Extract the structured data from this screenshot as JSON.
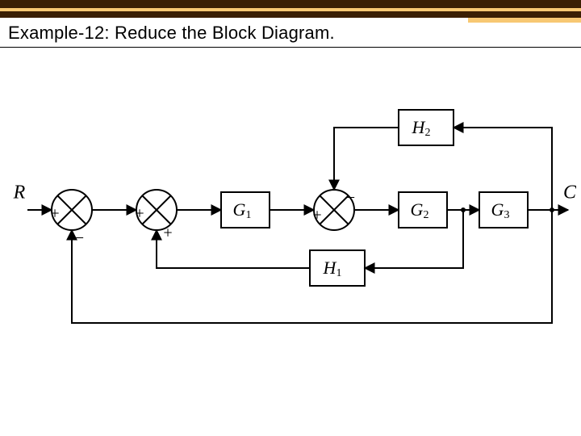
{
  "title": "Example-12: Reduce the Block Diagram.",
  "input_label": "R",
  "output_label": "C",
  "blocks": {
    "G1": "G",
    "G1_sub": "1",
    "G2": "G",
    "G2_sub": "2",
    "G3": "G",
    "G3_sub": "3",
    "H1": "H",
    "H1_sub": "1",
    "H2": "H",
    "H2_sub": "2"
  },
  "sums": {
    "s1_left": "+",
    "s1_bottom": "_",
    "s2_left": "+",
    "s2_bottom": "+",
    "s3_left": "+",
    "s3_top": "_"
  },
  "diagram_data": {
    "type": "block_diagram",
    "description": "Control-system block diagram with three summing junctions, forward blocks G1 G2 G3, feedback blocks H1 (positive, inner) and H2 (negative, middle), and unity negative feedback (outer).",
    "nodes": [
      {
        "id": "R",
        "kind": "input"
      },
      {
        "id": "S1",
        "kind": "sum",
        "signs": {
          "left": "+",
          "bottom": "-"
        }
      },
      {
        "id": "S2",
        "kind": "sum",
        "signs": {
          "left": "+",
          "bottom": "+"
        }
      },
      {
        "id": "G1",
        "kind": "block",
        "label": "G1"
      },
      {
        "id": "S3",
        "kind": "sum",
        "signs": {
          "left": "+",
          "top": "-"
        }
      },
      {
        "id": "G2",
        "kind": "block",
        "label": "G2"
      },
      {
        "id": "G3",
        "kind": "block",
        "label": "G3"
      },
      {
        "id": "C",
        "kind": "output"
      },
      {
        "id": "H1",
        "kind": "block",
        "label": "H1"
      },
      {
        "id": "H2",
        "kind": "block",
        "label": "H2"
      }
    ],
    "edges": [
      {
        "from": "R",
        "to": "S1"
      },
      {
        "from": "S1",
        "to": "S2"
      },
      {
        "from": "S2",
        "to": "G1"
      },
      {
        "from": "G1",
        "to": "S3"
      },
      {
        "from": "S3",
        "to": "G2"
      },
      {
        "from": "G2",
        "to": "G3"
      },
      {
        "from": "G3",
        "to": "C"
      },
      {
        "from": "G2_out",
        "to": "H1",
        "tap": "between G2 and G3"
      },
      {
        "from": "H1",
        "to": "S2",
        "sign": "+"
      },
      {
        "from": "C_tap",
        "to": "H2",
        "tap": "after G3"
      },
      {
        "from": "H2",
        "to": "S3",
        "sign": "-"
      },
      {
        "from": "C_tap",
        "to": "S1",
        "sign": "-",
        "note": "unity feedback"
      }
    ]
  }
}
